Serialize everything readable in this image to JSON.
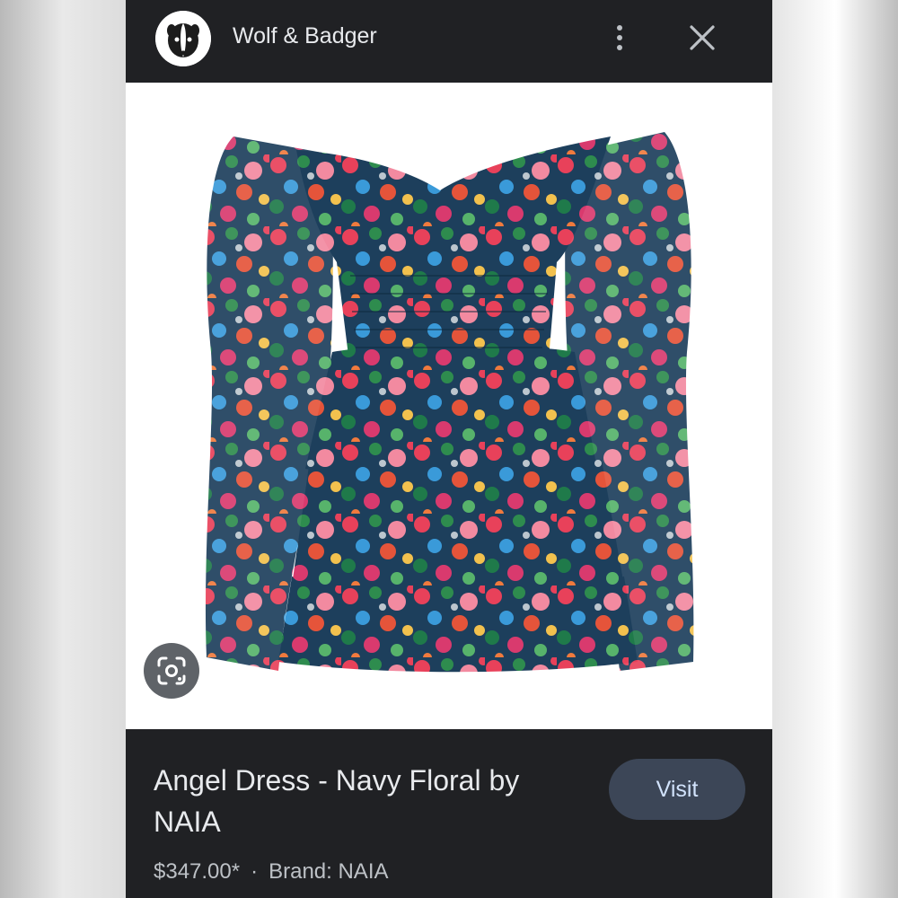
{
  "header": {
    "site_name": "Wolf & Badger",
    "logo_icon": "badger-logo-icon",
    "more_icon": "more-vert-icon",
    "close_icon": "close-icon"
  },
  "product_image": {
    "subject": "floral off-shoulder tiered mini dress",
    "lens_icon": "google-lens-icon"
  },
  "details": {
    "title": "Angel Dress - Navy Floral by NAIA",
    "visit_label": "Visit",
    "price": "$347.00*",
    "separator": "·",
    "brand": "Brand: NAIA"
  },
  "colors": {
    "panel_bg": "#202124",
    "visit_bg": "#3c4657",
    "visit_text": "#d2e3fc"
  }
}
